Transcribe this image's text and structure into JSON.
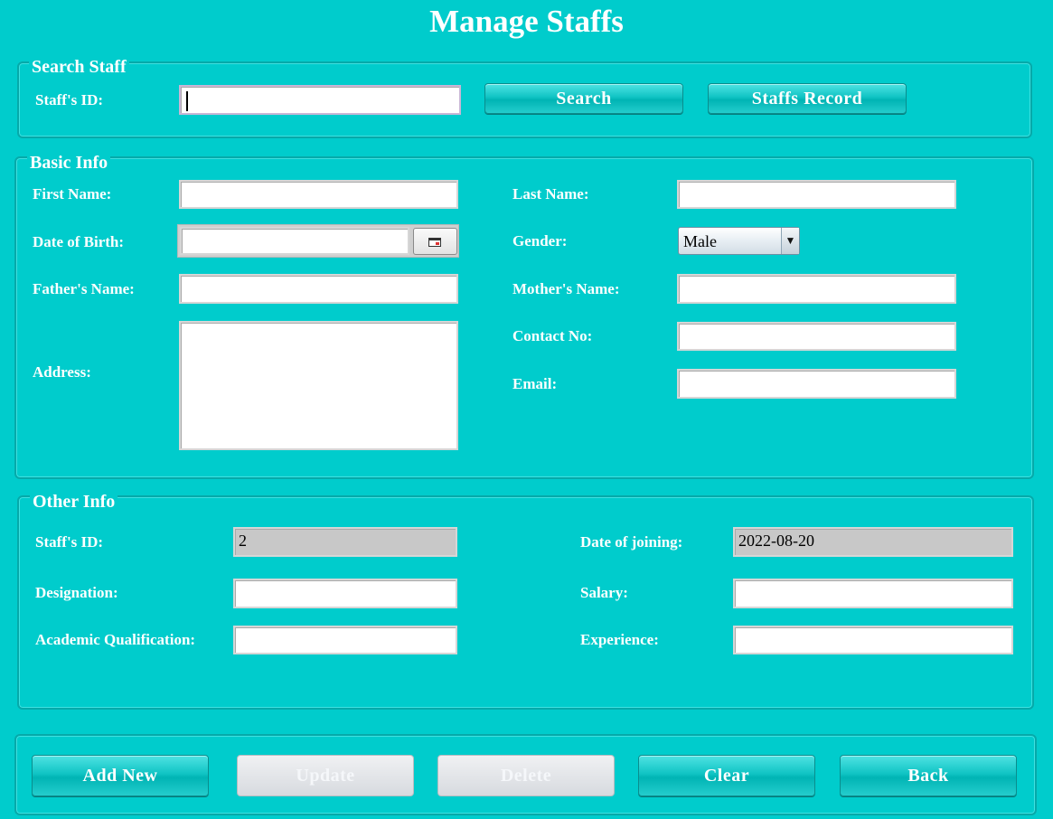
{
  "window_title": "Manage Staffs",
  "search_panel": {
    "legend": "Search Staff",
    "staff_id_label": "Staff's ID:",
    "staff_id_value": "",
    "search_button": "Search",
    "records_button": "Staffs Record"
  },
  "basic_info": {
    "legend": "Basic Info",
    "first_name_label": "First Name:",
    "first_name_value": "",
    "last_name_label": "Last Name:",
    "last_name_value": "",
    "dob_label": "Date of Birth:",
    "dob_value": "",
    "gender_label": "Gender:",
    "gender_value": "Male",
    "father_label": "Father's Name:",
    "father_value": "",
    "mother_label": "Mother's Name:",
    "mother_value": "",
    "address_label": "Address:",
    "address_value": "",
    "contact_label": "Contact No:",
    "contact_value": "",
    "email_label": "Email:",
    "email_value": ""
  },
  "other_info": {
    "legend": "Other Info",
    "staff_id_label": "Staff's ID:",
    "staff_id_value": "2",
    "joining_label": "Date of joining:",
    "joining_value": "2022-08-20",
    "designation_label": "Designation:",
    "designation_value": "",
    "salary_label": "Salary:",
    "salary_value": "",
    "qualification_label": "Academic Qualification:",
    "qualification_value": "",
    "experience_label": "Experience:",
    "experience_value": ""
  },
  "actions": {
    "add_new": "Add New",
    "update": "Update",
    "delete": "Delete",
    "clear": "Clear",
    "back": "Back"
  },
  "icons": {
    "dropdown": "▼",
    "calendar": "calendar-icon"
  },
  "colors": {
    "background": "#00CCCC",
    "readonly_field": "#C8C8C8"
  }
}
